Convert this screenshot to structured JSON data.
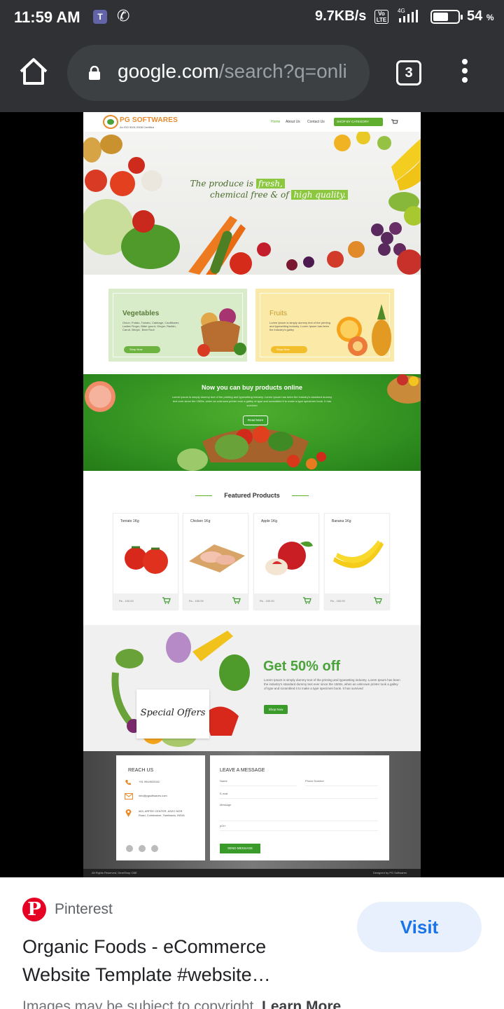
{
  "status_bar": {
    "time": "11:59 AM",
    "network_speed": "9.7KB/s",
    "network_type": "4G",
    "battery_percent": "54",
    "percent_sign": "%"
  },
  "browser": {
    "url_domain": "google.com",
    "url_path": "/search?q=onli",
    "tab_count": "3"
  },
  "preview": {
    "header": {
      "logo_text": "PG SOFTWARES",
      "logo_sub": "An ISO 9001:2008 Certified",
      "nav": [
        "Home",
        "About Us",
        "Contact Us"
      ],
      "shop_by_category": "SHOP BY CATEGORY"
    },
    "hero": {
      "line1_prefix": "The produce is",
      "line1_highlight": "fresh,",
      "line2_prefix": "chemical free & of",
      "line2_highlight": "high quality."
    },
    "categories": [
      {
        "title": "Vegetables",
        "desc": "Onion, Potato, Tomato, Cabbage, Cauliflower, Ladies Finger, Bitter gourd, Ginger, Radish, Carrot, Brinjal , Beet Root",
        "button": "Shop Now"
      },
      {
        "title": "Fruits",
        "desc": "Lorem Ipsum is simply dummy text of the printing and typesetting industry. Lorem Ipsum has been the industry's galley",
        "button": "Shop Now"
      }
    ],
    "promo": {
      "title": "Now you can buy products online",
      "desc": "Lorem Ipsum is simply dummy text of the printing and typesetting industry. Lorem Ipsum has been the industry's standard dummy text ever since the 1500s, when an unknown printer took a galley of type and scrambled it to make a type specimen book. It has survived",
      "button": "Read More"
    },
    "featured": {
      "title": "Featured Products",
      "products": [
        {
          "name": "Tomato 1Kg",
          "price": "Rs - 100.00"
        },
        {
          "name": "Chicken 1Kg",
          "price": "Rs - 150.00"
        },
        {
          "name": "Apple 1Kg",
          "price": "Rs - 150.00"
        },
        {
          "name": "Banana 1Kg",
          "price": "Rs - 150.00"
        }
      ]
    },
    "offers": {
      "special": "Special Offers",
      "headline": "Get 50% off",
      "desc": "Lorem Ipsum is simply dummy text of the printing and typesetting industry. Lorem Ipsum has been the industry's standard dummy text ever since the 1500s, when an unknown printer took a galley of type and scrambled it to make a type specimen book. It has survived",
      "button": "Shop Now"
    },
    "contact": {
      "reach_title": "REACH US",
      "phone": "+91 9944925341",
      "email": "info@pgsoftwares.com",
      "address": "#63, ARFEE CENTER, ASZO NGR Road, Coimbatore, Tamilnadu, INDIA",
      "message_title": "LEAVE A MESSAGE",
      "field_name": "Name",
      "field_phone": "Phone Number",
      "field_email": "E-mail",
      "field_message": "Message",
      "captcha": "pGt+",
      "send": "SEND MESSAGE"
    },
    "footer": {
      "left": "All Rights Reserved, DearShop CBE",
      "right": "Designed by PG Softwares"
    }
  },
  "result_card": {
    "source": "Pinterest",
    "visit": "Visit",
    "title": "Organic Foods - eCommerce Website Template #website…",
    "copyright_text": "Images may be subject to copyright.",
    "learn_more": "Learn More"
  },
  "colors": {
    "chrome_bg": "#303134",
    "accent_green": "#5fae2e",
    "pinterest_red": "#e60023",
    "link_blue": "#1a73e8"
  }
}
